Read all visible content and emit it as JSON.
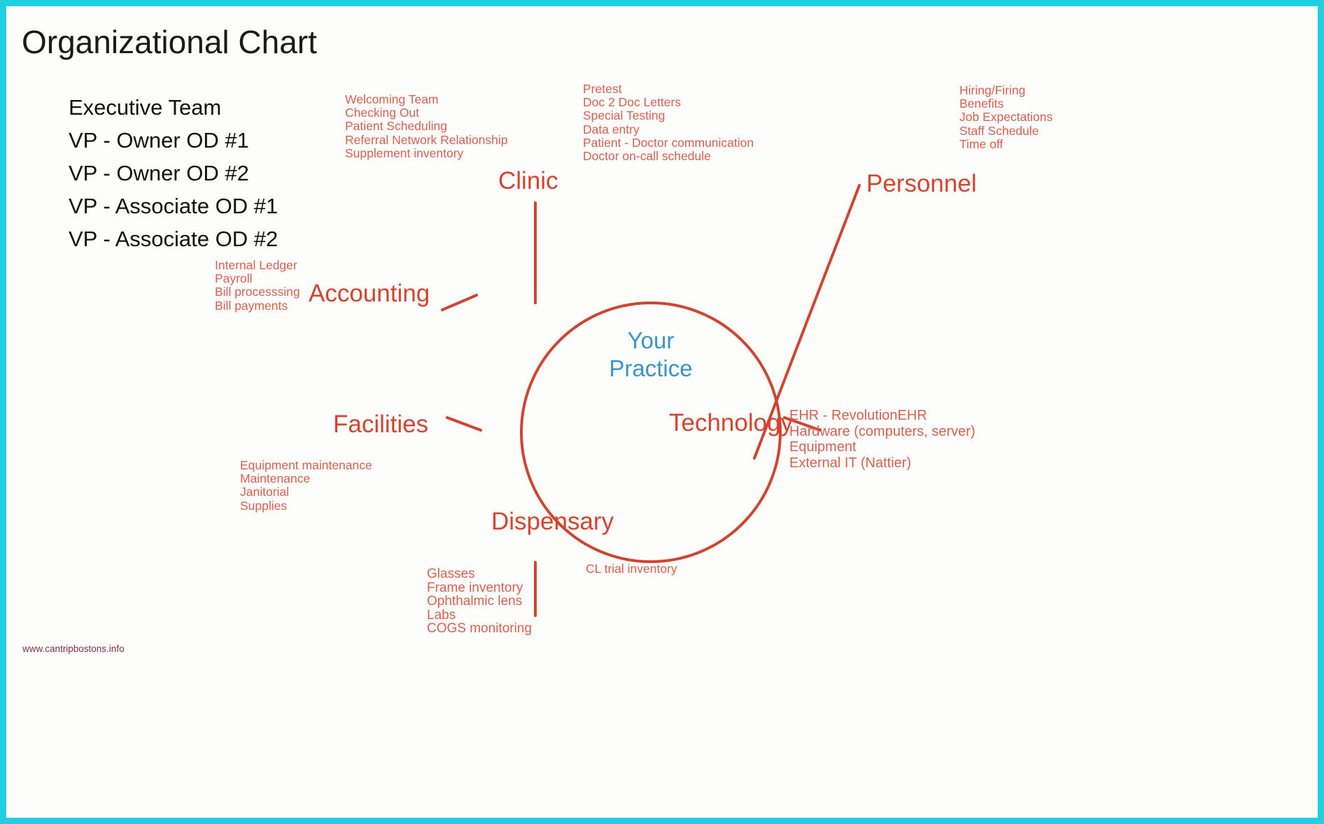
{
  "page": {
    "title": "Organizational Chart",
    "border_color": "#22cfe0",
    "accent_color": "#d6442f",
    "detail_color": "#d9604f",
    "hub_color": "#3a93c9",
    "footer_url": "www.cantripbostons.info"
  },
  "executive_team": {
    "heading": "Executive Team",
    "members": [
      "VP - Owner OD #1",
      "VP - Owner OD #2",
      "VP - Associate OD #1",
      "VP - Associate OD #2"
    ]
  },
  "hub": {
    "line1": "Your",
    "line2": "Practice"
  },
  "chart_data": {
    "type": "diagram",
    "layout": "radial-hub-and-spoke",
    "title": "Organizational Chart",
    "center": "Your Practice",
    "branches": [
      {
        "name": "Clinic",
        "position": "top",
        "items": [
          "Welcoming Team",
          "Checking Out",
          "Patient Scheduling",
          "Referral Network Relationship",
          "Supplement inventory"
        ],
        "items_secondary": [
          "Pretest",
          "Doc 2 Doc Letters",
          "Special Testing",
          "Data entry",
          "Patient - Doctor communication",
          "Doctor on-call schedule"
        ]
      },
      {
        "name": "Personnel",
        "position": "top-right",
        "items": [
          "Hiring/Firing",
          "Benefits",
          "Job Expectations",
          "Staff Schedule",
          "Time off"
        ]
      },
      {
        "name": "Accounting",
        "position": "upper-left",
        "items": [
          "Internal Ledger",
          "Payroll",
          "Bill processsing",
          "Bill payments"
        ]
      },
      {
        "name": "Technology",
        "position": "right",
        "items": [
          "EHR - RevolutionEHR",
          "Hardware (computers, server)",
          "Equipment",
          "External IT (Nattier)"
        ]
      },
      {
        "name": "Facilities",
        "position": "lower-left",
        "items": [
          "Equipment maintenance",
          "Maintenance",
          "Janitorial",
          "Supplies"
        ]
      },
      {
        "name": "Dispensary",
        "position": "bottom",
        "items": [
          "Glasses",
          "Frame inventory",
          "Ophthalmic lens",
          "Labs",
          "COGS monitoring"
        ],
        "items_secondary": [
          "CL trial inventory"
        ]
      }
    ]
  }
}
